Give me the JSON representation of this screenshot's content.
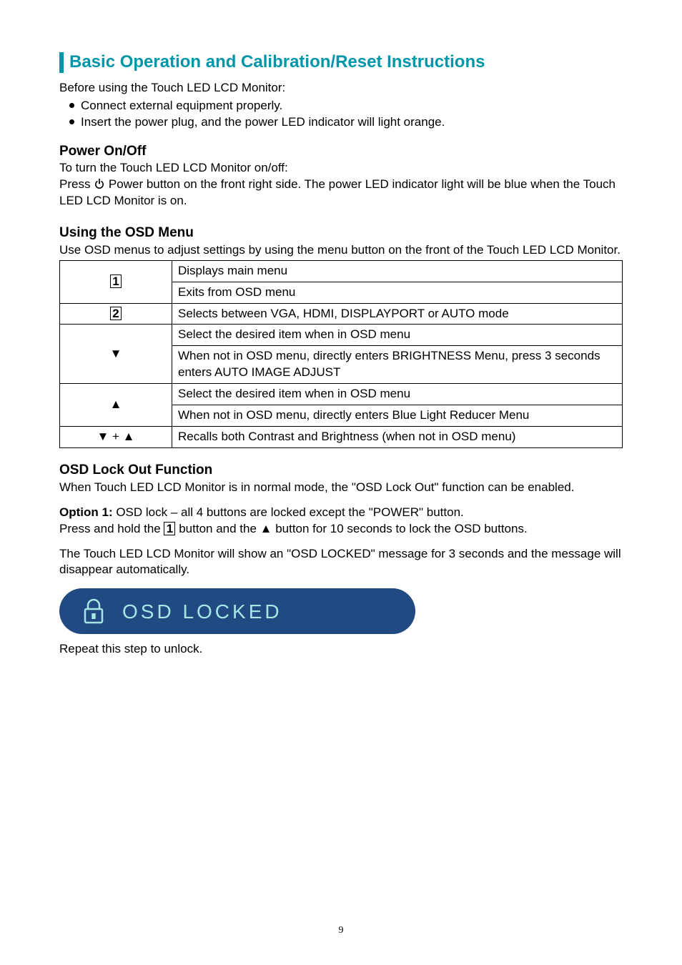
{
  "title": "Basic Operation and Calibration/Reset Instructions",
  "intro": "Before using the Touch LED LCD Monitor:",
  "bullets": [
    "Connect external equipment properly.",
    "Insert the power plug, and the power LED indicator will light orange."
  ],
  "power": {
    "heading": "Power On/Off",
    "l1": "To turn the Touch LED LCD Monitor on/off:",
    "l2a": "Press ",
    "l2b": " Power button on the front right side. The power LED indicator light will be blue when the Touch LED LCD Monitor is on."
  },
  "osd": {
    "heading": "Using the OSD Menu",
    "lead": "Use OSD menus to adjust settings by using the menu button on the front of the Touch LED LCD Monitor.",
    "rows": {
      "b1a": "Displays main menu",
      "b1b": "Exits from OSD menu",
      "b2": "Selects between VGA, HDMI, DISPLAYPORT or AUTO mode",
      "dn1": "Select the desired item when in OSD menu",
      "dn2": "When not in OSD menu, directly enters BRIGHTNESS Menu, press 3 seconds enters AUTO IMAGE ADJUST",
      "up1": "Select the desired item when in OSD menu",
      "up2": "When not in OSD menu, directly enters Blue Light Reducer Menu",
      "both": "Recalls both Contrast and Brightness (when not in OSD menu)"
    }
  },
  "lock": {
    "heading": "OSD Lock Out Function",
    "lead": "When Touch LED LCD Monitor is in normal mode, the \"OSD Lock Out\" function can be enabled.",
    "opt1_label": "Option 1: ",
    "opt1_rest": "OSD lock – all 4 buttons are locked except the \"POWER\" button.",
    "opt1_l2a": "Press and hold the ",
    "opt1_btn": "1",
    "opt1_l2b": " button and the ",
    "opt1_tri": "▲",
    "opt1_l2c": " button for 10 seconds to lock the OSD buttons.",
    "note": "The Touch LED LCD Monitor will show an \"OSD LOCKED\" message for 3 seconds and the message will disappear automatically.",
    "banner": "OSD  LOCKED",
    "repeat": "Repeat this step to unlock."
  },
  "keys": {
    "b1": "1",
    "b2": "2",
    "down": "▼",
    "up": "▲",
    "both": "▼ + ▲"
  },
  "page_number": "9"
}
